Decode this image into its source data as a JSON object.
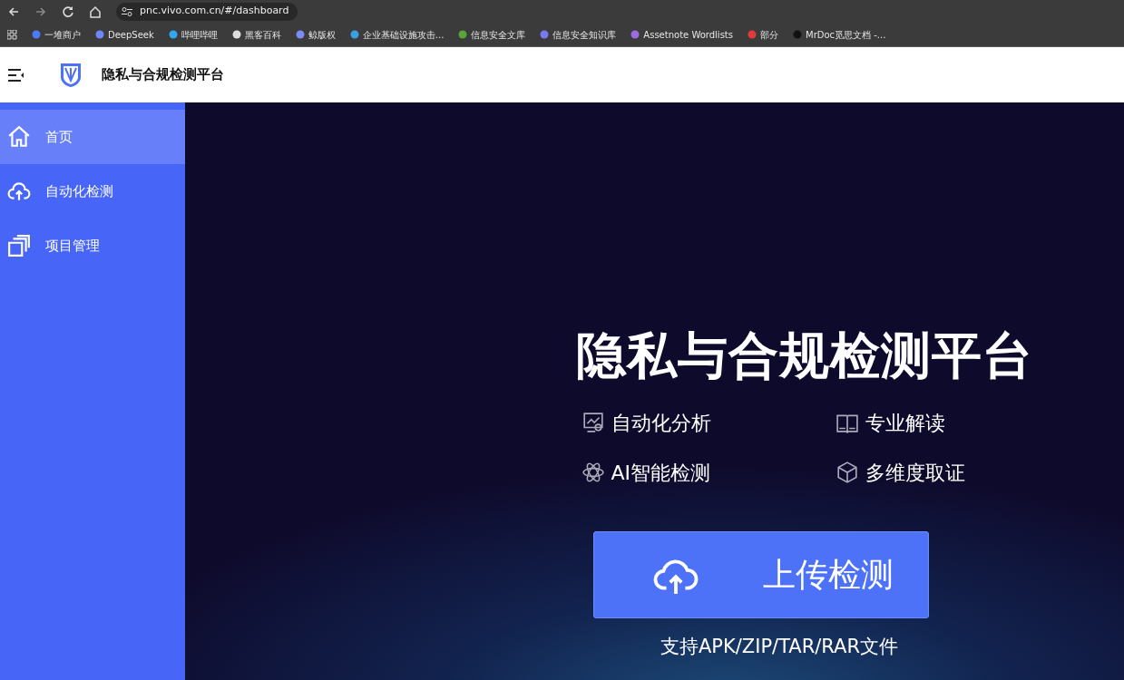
{
  "browser": {
    "url": "pnc.vivo.com.cn/#/dashboard",
    "bookmarks": [
      "一堆商户",
      "DeepSeek",
      "哔哩哔哩",
      "黑客百科",
      "鲸版权",
      "企业基础设施攻击...",
      "信息安全文库",
      "信息安全知识库",
      "Assetnote Wordlists",
      "部分",
      "MrDoc觅思文档 -..."
    ]
  },
  "header": {
    "title": "隐私与合规检测平台"
  },
  "sidebar": {
    "items": [
      {
        "label": "首页",
        "selected": true
      },
      {
        "label": "自动化检测",
        "selected": false
      },
      {
        "label": "项目管理",
        "selected": false
      }
    ]
  },
  "hero": {
    "title": "隐私与合规检测平台",
    "features": [
      "自动化分析",
      "专业解读",
      "AI智能检测",
      "多维度取证"
    ],
    "upload_button": "上传检测",
    "hint": "支持APK/ZIP/TAR/RAR文件"
  }
}
